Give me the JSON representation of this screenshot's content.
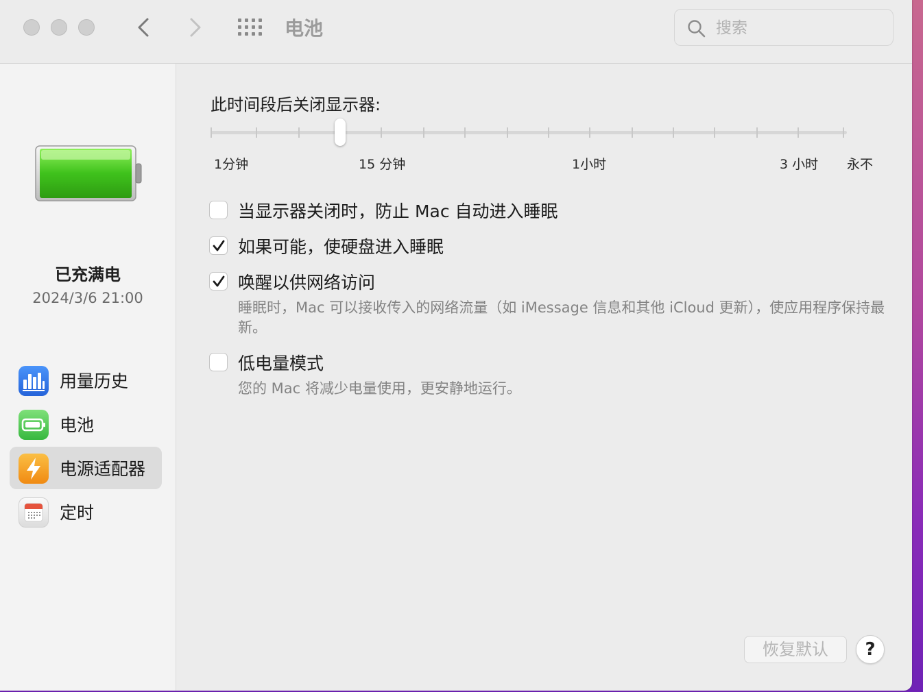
{
  "window": {
    "title": "电池",
    "search_placeholder": "搜索"
  },
  "sidebar": {
    "status": "已充满电",
    "timestamp": "2024/3/6 21:00",
    "items": [
      {
        "label": "用量历史",
        "icon": "usage-history-icon"
      },
      {
        "label": "电池",
        "icon": "battery-icon"
      },
      {
        "label": "电源适配器",
        "icon": "power-adapter-icon",
        "selected": true
      },
      {
        "label": "定时",
        "icon": "schedule-icon"
      }
    ]
  },
  "main": {
    "display_off_label": "此时间段后关闭显示器:",
    "slider": {
      "value": "15 分钟",
      "labels": [
        "1分钟",
        "15 分钟",
        "1小时",
        "3 小时",
        "永不"
      ]
    },
    "options": [
      {
        "label": "当显示器关闭时，防止 Mac 自动进入睡眠",
        "checked": false
      },
      {
        "label": "如果可能，使硬盘进入睡眠",
        "checked": true
      },
      {
        "label": "唤醒以供网络访问",
        "checked": true,
        "description": "睡眠时，Mac 可以接收传入的网络流量（如 iMessage 信息和其他 iCloud 更新），使应用程序保持最新。"
      },
      {
        "label": "低电量模式",
        "checked": false,
        "description": "您的 Mac 将减少电量使用，更安静地运行。"
      }
    ],
    "restore_defaults_label": "恢复默认",
    "help_label": "?"
  },
  "colors": {
    "battery_green": "#3fc21c",
    "usage_blue": "#2f7cf6",
    "adapter_orange": "#f5a623",
    "calendar_red": "#e5533d"
  }
}
